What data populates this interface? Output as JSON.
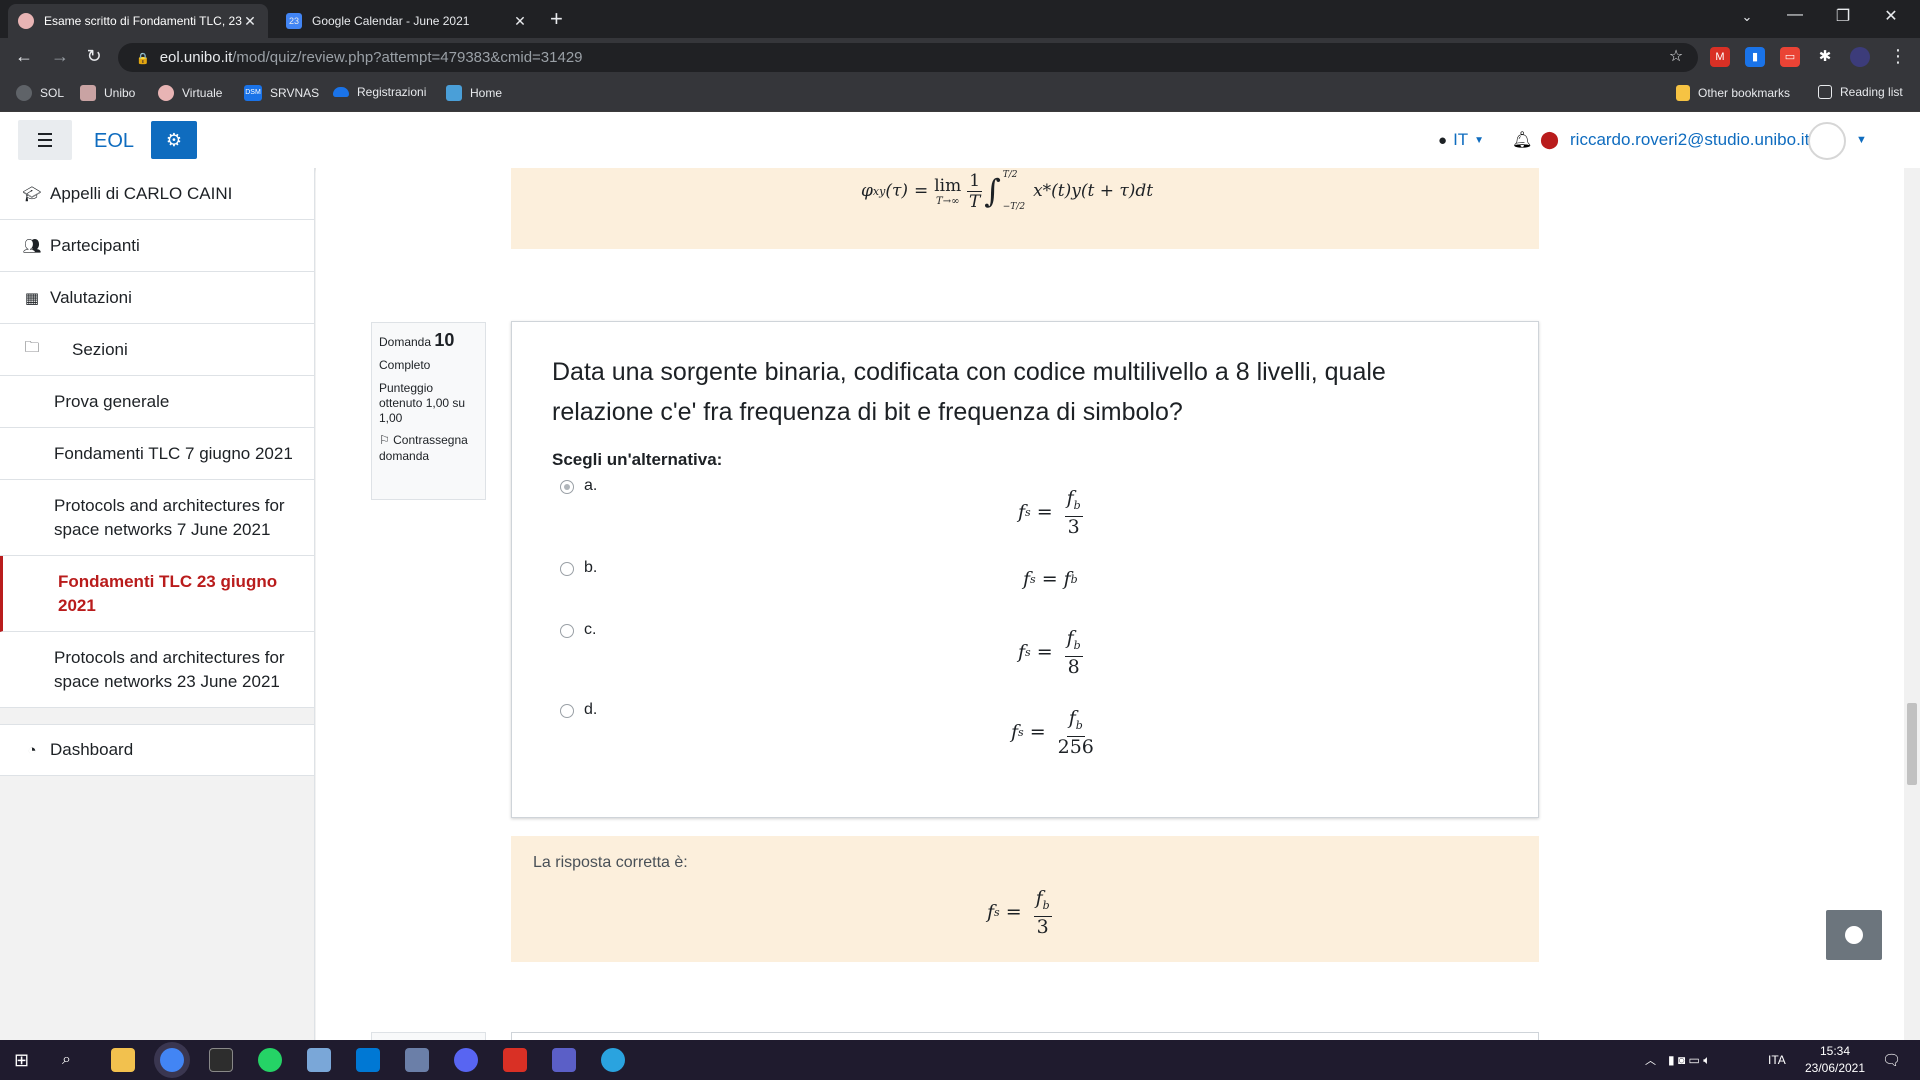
{
  "browser": {
    "tabs": [
      {
        "title": "Esame scritto di Fondamenti TLC, 23",
        "active": true
      },
      {
        "title": "Google Calendar - June 2021",
        "active": false,
        "badge": "23"
      }
    ],
    "url_host": "eol.unibo.it",
    "url_path": "/mod/quiz/review.php?attempt=479383&cmid=31429",
    "bookmarks": [
      "SOL",
      "Unibo",
      "Virtuale",
      "SRVNAS",
      "Registrazioni",
      "Home"
    ],
    "bookmarks_right": [
      "Other bookmarks",
      "Reading list"
    ],
    "srvnas_icon_text": "DSM"
  },
  "header": {
    "brand": "EOL",
    "language": "IT",
    "user_email": "riccardo.roveri2@studio.unibo.it"
  },
  "drawer": {
    "items": [
      {
        "label": "Appelli di CARLO CAINI",
        "icon": "graduation-cap-icon"
      },
      {
        "label": "Partecipanti",
        "icon": "users-icon"
      },
      {
        "label": "Valutazioni",
        "icon": "table-icon"
      },
      {
        "label": "Sezioni",
        "icon": "folder-icon"
      }
    ],
    "sections": [
      {
        "label": "Prova generale",
        "active": false
      },
      {
        "label": "Fondamenti TLC 7 giugno 2021",
        "active": false
      },
      {
        "label": "Protocols and architectures for space networks 7 June 2021",
        "active": false
      },
      {
        "label": "Fondamenti TLC 23 giugno 2021",
        "active": true
      },
      {
        "label": "Protocols and architectures for space networks 23 June 2021",
        "active": false
      }
    ],
    "dashboard": "Dashboard"
  },
  "question": {
    "label": "Domanda",
    "number": "10",
    "state": "Completo",
    "grade": "Punteggio ottenuto 1,00 su 1,00",
    "flag": "Contrassegna domanda",
    "text": "Data una sorgente binaria, codificata con codice multilivello a 8 livelli, quale relazione c'e' fra frequenza di bit e frequenza di simbolo?",
    "prompt": "Scegli un'alternativa:",
    "options": [
      {
        "letter": "a.",
        "lhs": "f",
        "lhs_sub": "s",
        "num": "f",
        "num_sub": "b",
        "den": "3",
        "selected": true
      },
      {
        "letter": "b.",
        "lhs": "f",
        "lhs_sub": "s",
        "rhs": "f",
        "rhs_sub": "b",
        "selected": false
      },
      {
        "letter": "c.",
        "lhs": "f",
        "lhs_sub": "s",
        "num": "f",
        "num_sub": "b",
        "den": "8",
        "selected": false
      },
      {
        "letter": "d.",
        "lhs": "f",
        "lhs_sub": "s",
        "num": "f",
        "num_sub": "b",
        "den": "256",
        "selected": false
      }
    ],
    "correct_label": "La risposta corretta è:",
    "correct": {
      "lhs": "f",
      "lhs_sub": "s",
      "num": "f",
      "num_sub": "b",
      "den": "3"
    }
  },
  "previous_feedback": {
    "formula": {
      "lhs": "φ",
      "lhs_sub": "xy",
      "arg": "(τ)",
      "lim": "lim",
      "lim_sub": "T→∞",
      "frac_num": "1",
      "frac_den": "T",
      "integrand": "x*(t)y(t + τ)dt",
      "upper_limit": "T/2",
      "lower_limit": "−T/2"
    }
  },
  "taskbar": {
    "language": "ITA",
    "time": "15:34",
    "date": "23/06/2021"
  }
}
